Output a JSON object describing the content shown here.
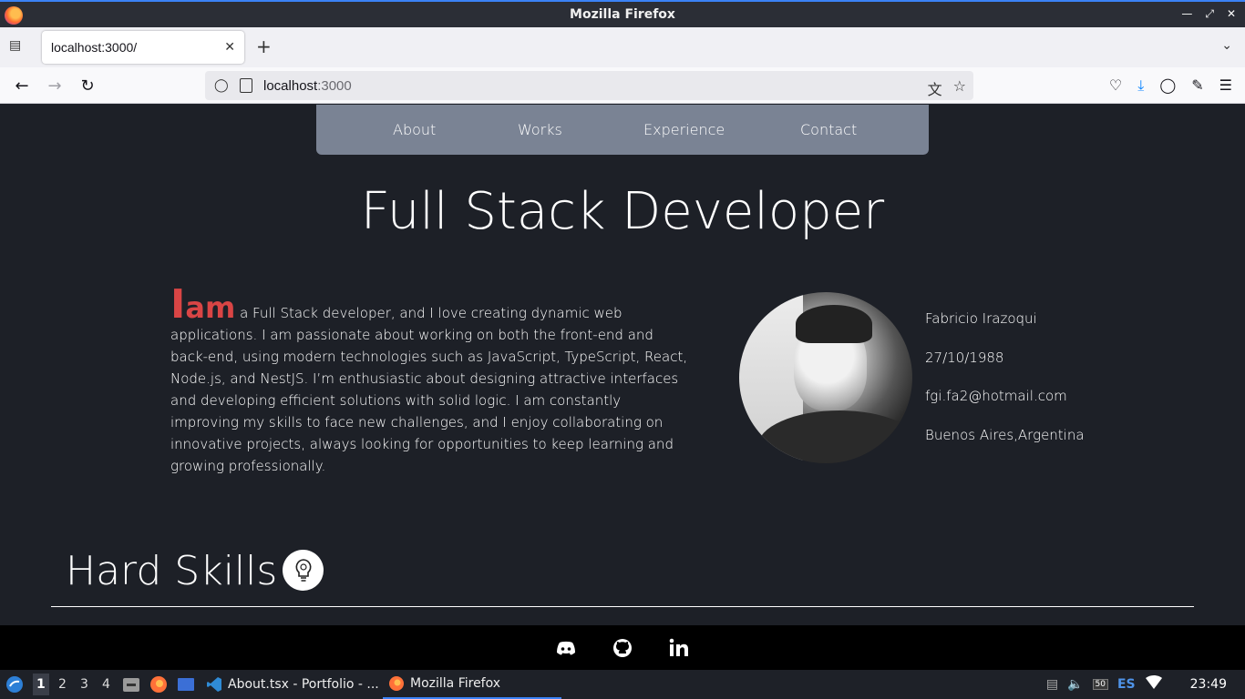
{
  "window": {
    "title": "Mozilla Firefox"
  },
  "tab": {
    "title": "localhost:3000/"
  },
  "url": {
    "host": "localhost",
    "port": ":3000"
  },
  "site": {
    "nav": [
      "About",
      "Works",
      "Experience",
      "Contact"
    ],
    "hero_title": "Full Stack Developer",
    "bio_i": "I",
    "bio_am": "am",
    "bio_text": " a Full Stack developer, and I love creating dynamic web applications. I am passionate about working on both the front-end and back-end, using modern technologies such as JavaScript, TypeScript, React, Node.js, and NestJS. I’m enthusiastic about designing attractive interfaces and developing efficient solutions with solid logic. I am constantly improving my skills to face new challenges, and I enjoy collaborating on innovative projects, always looking for opportunities to keep learning and growing professionally.",
    "info": [
      "Fabricio Irazoqui",
      "27/10/1988",
      "fgi.fa2@hotmail.com",
      "Buenos Aires,Argentina"
    ],
    "section_title": "Hard Skills",
    "accent": "#d94545"
  },
  "taskbar": {
    "workspaces": [
      "1",
      "2",
      "3",
      "4"
    ],
    "tasks": [
      "About.tsx - Portfolio - ...",
      "Mozilla Firefox"
    ],
    "battery": "50",
    "lang": "ES",
    "clock": "23:49"
  }
}
